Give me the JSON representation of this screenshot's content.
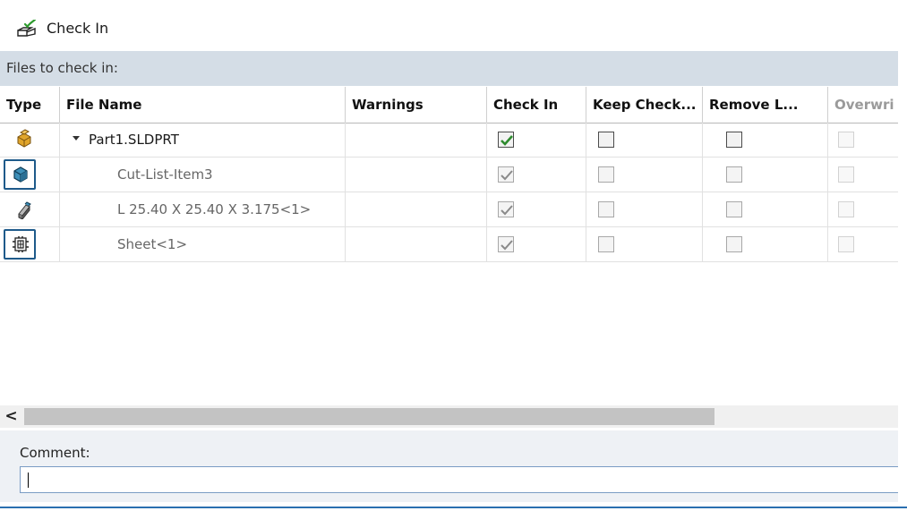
{
  "title": {
    "label": "Check In",
    "icon": "check-in-icon"
  },
  "section_header": "Files to check in:",
  "columns": [
    {
      "key": "type",
      "label": "Type"
    },
    {
      "key": "file_name",
      "label": "File Name"
    },
    {
      "key": "warnings",
      "label": "Warnings"
    },
    {
      "key": "check_in",
      "label": "Check In"
    },
    {
      "key": "keep_checked_out",
      "label": "Keep Check..."
    },
    {
      "key": "remove_local",
      "label": "Remove L..."
    },
    {
      "key": "overwrite",
      "label": "Overwri"
    }
  ],
  "rows": [
    {
      "icon": "part-icon",
      "name": "Part1.SLDPRT",
      "expanded": true,
      "warnings": "",
      "check_in": true,
      "keep_checked_out": false,
      "remove_local": false,
      "overwrite": false,
      "highlighted": false
    },
    {
      "icon": "cut-list-item-icon",
      "name": "Cut-List-Item3",
      "warnings": "",
      "check_in": true,
      "keep_checked_out": false,
      "remove_local": false,
      "overwrite": false,
      "highlighted": true
    },
    {
      "icon": "structural-member-icon",
      "name": "L 25.40 X 25.40 X 3.175<1>",
      "warnings": "",
      "check_in": true,
      "keep_checked_out": false,
      "remove_local": false,
      "overwrite": false,
      "highlighted": false
    },
    {
      "icon": "sheet-metal-icon",
      "name": "Sheet<1>",
      "warnings": "",
      "check_in": true,
      "keep_checked_out": false,
      "remove_local": false,
      "overwrite": false,
      "highlighted": true
    }
  ],
  "scrollbar": {
    "left_arrow": "<"
  },
  "comment": {
    "label": "Comment:",
    "value": ""
  },
  "colors": {
    "header_band": "#d4dde6",
    "highlight_border": "#1e5a8a",
    "check_green": "#2e8b2e",
    "accent_line": "#2a6fb0"
  }
}
